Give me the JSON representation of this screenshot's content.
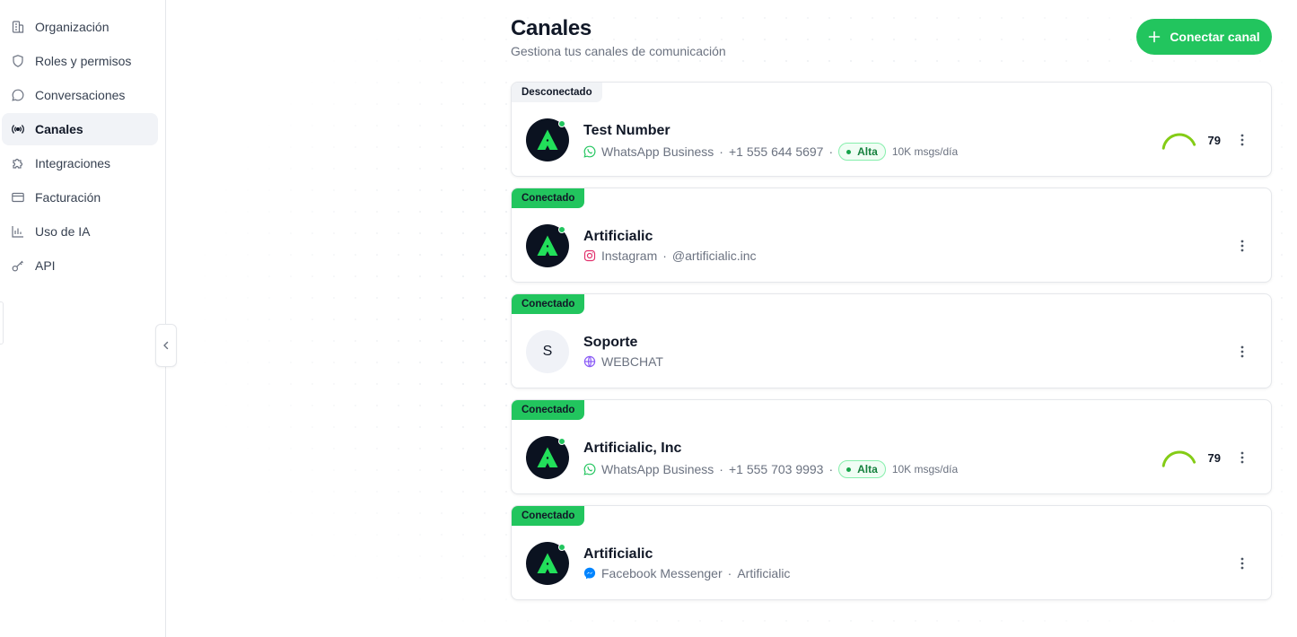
{
  "sidebar": {
    "items": [
      {
        "label": "Organización",
        "icon": "building-icon",
        "active": false
      },
      {
        "label": "Roles y permisos",
        "icon": "shield-icon",
        "active": false
      },
      {
        "label": "Conversaciones",
        "icon": "chat-bubble-icon",
        "active": false
      },
      {
        "label": "Canales",
        "icon": "radio-broadcast-icon",
        "active": true
      },
      {
        "label": "Integraciones",
        "icon": "puzzle-icon",
        "active": false
      },
      {
        "label": "Facturación",
        "icon": "credit-card-icon",
        "active": false
      },
      {
        "label": "Uso de IA",
        "icon": "bar-chart-icon",
        "active": false
      },
      {
        "label": "API",
        "icon": "key-icon",
        "active": false
      }
    ]
  },
  "header": {
    "title": "Canales",
    "subtitle": "Gestiona tus canales de comunicación",
    "connect_button": "Conectar canal"
  },
  "channels": [
    {
      "status": "Desconectado",
      "status_key": "off",
      "name": "Test Number",
      "platform": "WhatsApp Business",
      "platform_icon": "whatsapp-icon",
      "handle": "+1 555 644 5697",
      "tier": "Alta",
      "limit": "10K msgs/día",
      "score": "79",
      "score_fraction": 0.79,
      "avatar": "logo",
      "online": true
    },
    {
      "status": "Conectado",
      "status_key": "on",
      "name": "Artificialic",
      "platform": "Instagram",
      "platform_icon": "instagram-icon",
      "handle": "@artificialic.inc",
      "avatar": "logo",
      "online": true
    },
    {
      "status": "Conectado",
      "status_key": "on",
      "name": "Soporte",
      "platform": "WEBCHAT",
      "platform_icon": "globe-icon",
      "avatar": "letter",
      "avatar_letter": "S"
    },
    {
      "status": "Conectado",
      "status_key": "on",
      "name": "Artificialic, Inc",
      "platform": "WhatsApp Business",
      "platform_icon": "whatsapp-icon",
      "handle": "+1 555 703 9993",
      "tier": "Alta",
      "limit": "10K msgs/día",
      "score": "79",
      "score_fraction": 0.79,
      "avatar": "logo",
      "online": true
    },
    {
      "status": "Conectado",
      "status_key": "on",
      "name": "Artificialic",
      "platform": "Facebook Messenger",
      "platform_icon": "messenger-icon",
      "handle": "Artificialic",
      "avatar": "logo",
      "online": true
    }
  ],
  "colors": {
    "accent": "#22c55e",
    "gauge": "#84cc16",
    "whatsapp": "#22c55e",
    "instagram": "#e1306c",
    "webchat": "#8b5cf6",
    "messenger": "#0084ff"
  }
}
